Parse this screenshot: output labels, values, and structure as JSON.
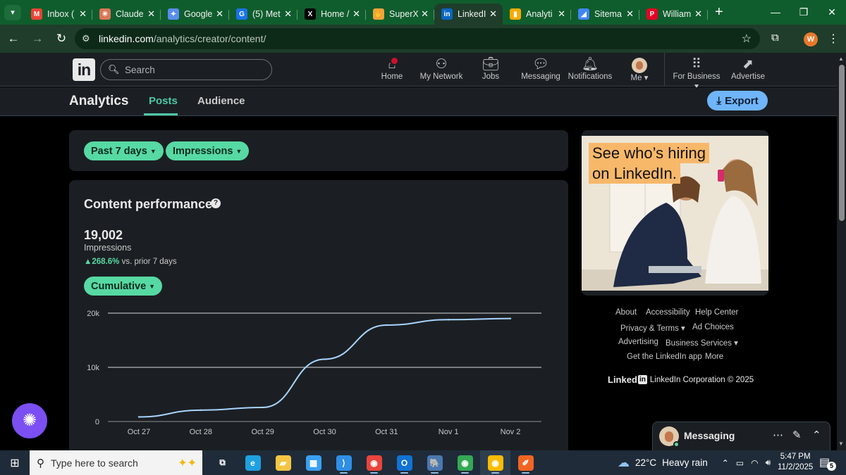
{
  "browser": {
    "tabs": [
      {
        "title": "Inbox (",
        "icon": "gmail-icon",
        "glyph": "M",
        "color": "#ea4335"
      },
      {
        "title": "Claude",
        "icon": "claude-icon",
        "glyph": "✳",
        "color": "#d97757"
      },
      {
        "title": "Google",
        "icon": "gemini-icon",
        "glyph": "✦",
        "color": "#5b8def"
      },
      {
        "title": "(5) Met",
        "icon": "meta-icon",
        "glyph": "G",
        "color": "#1a73e8"
      },
      {
        "title": "Home /",
        "icon": "x-icon",
        "glyph": "X",
        "color": "#000000"
      },
      {
        "title": "SuperX",
        "icon": "superx-icon",
        "glyph": "✋",
        "color": "#f2a33a"
      },
      {
        "title": "LinkedI",
        "icon": "linkedin-icon",
        "glyph": "in",
        "color": "#0a66c2"
      },
      {
        "title": "Analyti",
        "icon": "analytics-icon",
        "glyph": "▮",
        "color": "#f9ab00"
      },
      {
        "title": "Sitema",
        "icon": "search-console-icon",
        "glyph": "◢",
        "color": "#4285f4"
      },
      {
        "title": "William",
        "icon": "pinterest-icon",
        "glyph": "P",
        "color": "#e60023"
      }
    ],
    "active_tab_index": 6,
    "url_host": "linkedin.com",
    "url_path": "/analytics/creator/content/",
    "profile_initial": "W"
  },
  "linkedin": {
    "logo": "in",
    "search_placeholder": "Search",
    "nav": [
      {
        "label": "Home",
        "icon": "home-icon"
      },
      {
        "label": "My Network",
        "icon": "network-icon"
      },
      {
        "label": "Jobs",
        "icon": "briefcase-icon"
      },
      {
        "label": "Messaging",
        "icon": "messaging-icon"
      },
      {
        "label": "Notifications",
        "icon": "bell-icon"
      },
      {
        "label": "Me ▾",
        "icon": "avatar"
      },
      {
        "label": "For Business ▾",
        "icon": "grid-icon"
      },
      {
        "label": "Advertise",
        "icon": "compass-icon"
      }
    ]
  },
  "analytics": {
    "title": "Analytics",
    "tabs": [
      "Posts",
      "Audience"
    ],
    "active_tab": "Posts",
    "export_label": "Export",
    "filters": {
      "range": "Past 7 days",
      "metric": "Impressions"
    },
    "performance": {
      "title": "Content performance",
      "value": "19,002",
      "metric_label": "Impressions",
      "delta": "268.6%",
      "delta_suffix": "vs. prior 7 days",
      "mode": "Cumulative"
    }
  },
  "chart_data": {
    "type": "line",
    "title": "",
    "xlabel": "",
    "ylabel": "",
    "categories": [
      "Oct 27",
      "Oct 28",
      "Oct 29",
      "Oct 30",
      "Oct 31",
      "Nov 1",
      "Nov 2"
    ],
    "series": [
      {
        "values": [
          850,
          2100,
          2600,
          11500,
          17800,
          18800,
          19002
        ],
        "color": "#a8d4ff"
      }
    ],
    "ylim": [
      0,
      20000
    ],
    "yticks": [
      0,
      10000,
      20000
    ],
    "ytick_labels": [
      "0",
      "10k",
      "20k"
    ],
    "grid": true,
    "legend": "none"
  },
  "ad": {
    "line1": "See who’s hiring",
    "line2": "on LinkedIn."
  },
  "footer": {
    "links": [
      "About",
      "Accessibility",
      "Help Center",
      "Privacy & Terms ▾",
      "Ad Choices",
      "Advertising",
      "Business Services ▾",
      "Get the LinkedIn app",
      "More"
    ],
    "brand": "Linked",
    "copyright": "LinkedIn Corporation © 2025"
  },
  "messaging": {
    "label": "Messaging"
  },
  "taskbar": {
    "search_placeholder": "Type here to search",
    "apps": [
      {
        "name": "task-view-icon",
        "glyph": "⧉",
        "color": "#ffffff"
      },
      {
        "name": "edge-icon",
        "glyph": "e",
        "color": "#1fa0e0"
      },
      {
        "name": "file-explorer-icon",
        "glyph": "▰",
        "color": "#f4c542"
      },
      {
        "name": "store-icon",
        "glyph": "▦",
        "color": "#3aa0f3"
      },
      {
        "name": "vscode-icon",
        "glyph": "⟩",
        "color": "#2f8ee6"
      },
      {
        "name": "chrome-icon",
        "glyph": "◉",
        "color": "#e8453c"
      },
      {
        "name": "outlook-icon",
        "glyph": "O",
        "color": "#1273d4"
      },
      {
        "name": "postgres-icon",
        "glyph": "🐘",
        "color": "#4a78b0"
      },
      {
        "name": "chrome-profile-icon",
        "glyph": "◉",
        "color": "#34a853"
      },
      {
        "name": "chrome-active-icon",
        "glyph": "◉",
        "color": "#fbbc05"
      },
      {
        "name": "app-orange-icon",
        "glyph": "✐",
        "color": "#f26522"
      }
    ],
    "weather_temp": "22°C",
    "weather_desc": "Heavy rain",
    "time": "5:47 PM",
    "date": "11/2/2025",
    "notification_count": "5"
  }
}
